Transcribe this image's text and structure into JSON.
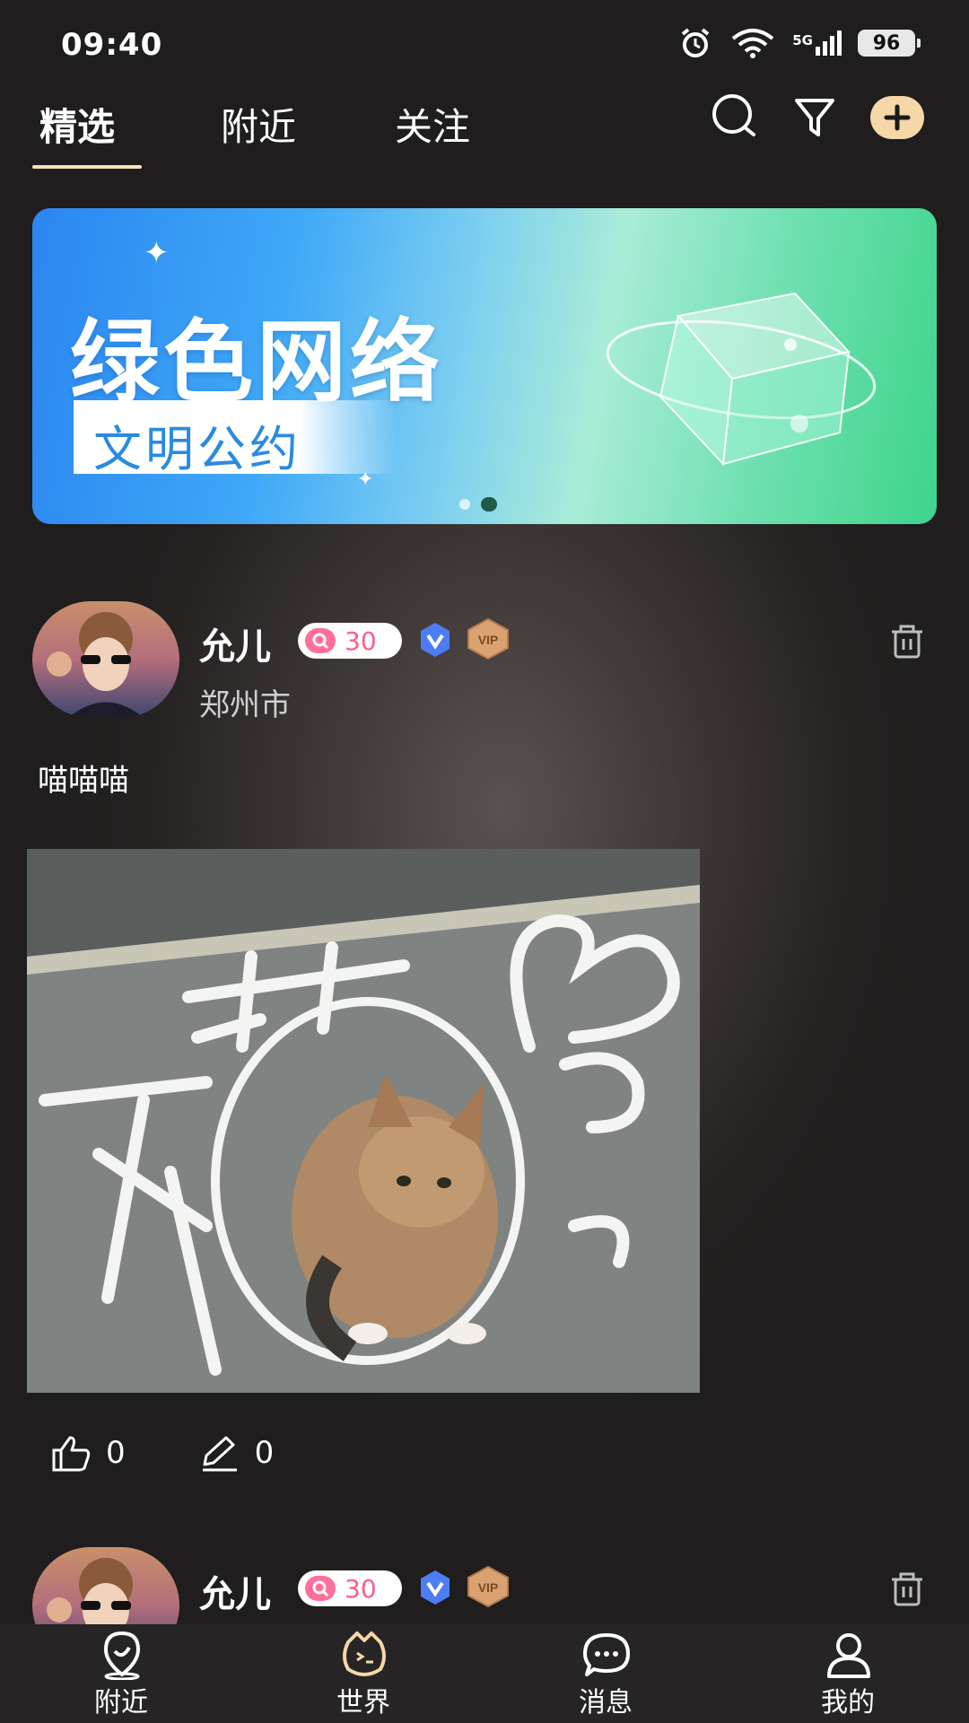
{
  "status_bar": {
    "time": "09:40",
    "network": "5G",
    "battery": "96"
  },
  "top_tabs": [
    {
      "label": "精选",
      "active": true
    },
    {
      "label": "附近",
      "active": false
    },
    {
      "label": "关注",
      "active": false
    }
  ],
  "top_actions": [
    "search-icon",
    "filter-icon",
    "add-icon"
  ],
  "banner": {
    "title": "绿色网络",
    "subtitle": "文明公约",
    "page_count": 2,
    "active_page": 2
  },
  "posts": [
    {
      "username": "允儿",
      "level": "30",
      "location": "郑州市",
      "content": "喵喵喵",
      "likes": "0",
      "comments": "0"
    },
    {
      "username": "允儿",
      "level": "30"
    }
  ],
  "bottom_nav": [
    {
      "label": "附近",
      "icon": "nearby-icon"
    },
    {
      "label": "世界",
      "icon": "world-icon"
    },
    {
      "label": "消息",
      "icon": "message-icon"
    },
    {
      "label": "我的",
      "icon": "profile-icon"
    }
  ],
  "colors": {
    "accent": "#f5d7a8",
    "tab_underline": "#f2e6b8",
    "level_pink": "#ff5e8d"
  }
}
